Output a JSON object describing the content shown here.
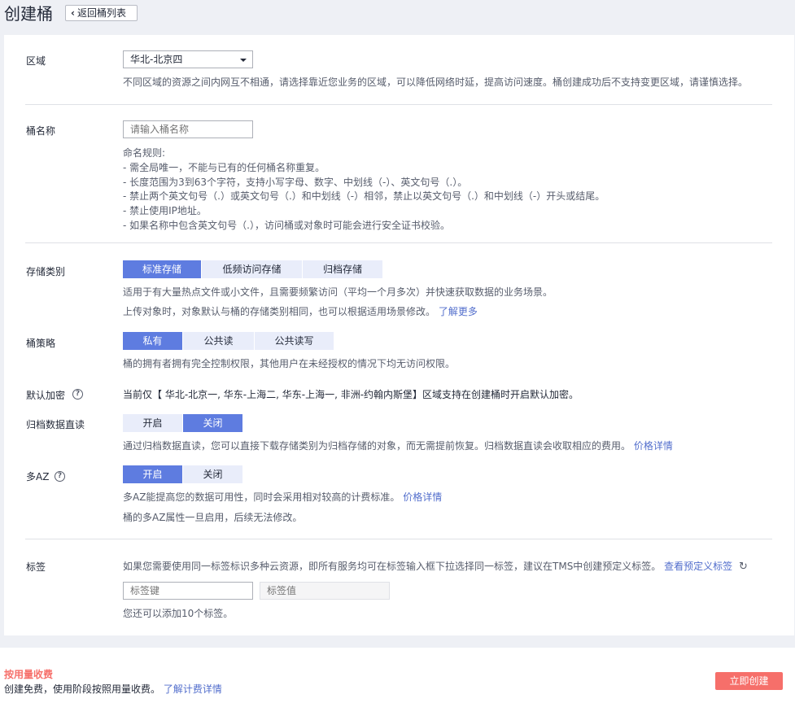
{
  "header": {
    "title": "创建桶",
    "back_label": "返回桶列表"
  },
  "region": {
    "label": "区域",
    "selected": "华北-北京四",
    "hint": "不同区域的资源之间内网互不相通，请选择靠近您业务的区域，可以降低网络时延，提高访问速度。桶创建成功后不支持变更区域，请谨慎选择。"
  },
  "bucket_name": {
    "label": "桶名称",
    "placeholder": "请输入桶名称",
    "rules": [
      "命名规则:",
      "- 需全局唯一，不能与已有的任何桶名称重复。",
      "- 长度范围为3到63个字符，支持小写字母、数字、中划线（-）、英文句号（.）。",
      "- 禁止两个英文句号（.）或英文句号（.）和中划线（-）相邻，禁止以英文句号（.）和中划线（-）开头或结尾。",
      "- 禁止使用IP地址。",
      "- 如果名称中包含英文句号（.），访问桶或对象时可能会进行安全证书校验。"
    ]
  },
  "storage_class": {
    "label": "存储类别",
    "options": [
      "标准存储",
      "低频访问存储",
      "归档存储"
    ],
    "hint1": "适用于有大量热点文件或小文件，且需要频繁访问（平均一个月多次）并快速获取数据的业务场景。",
    "hint2": "上传对象时，对象默认与桶的存储类别相同，也可以根据适用场景修改。",
    "learn_more": "了解更多"
  },
  "policy": {
    "label": "桶策略",
    "options": [
      "私有",
      "公共读",
      "公共读写"
    ],
    "hint": "桶的拥有者拥有完全控制权限，其他用户在未经授权的情况下均无访问权限。"
  },
  "encryption": {
    "label": "默认加密",
    "text": "当前仅【 华北-北京一, 华东-上海二, 华东-上海一, 非洲-约翰内斯堡】区域支持在创建桶时开启默认加密。"
  },
  "archive_read": {
    "label": "归档数据直读",
    "options": [
      "开启",
      "关闭"
    ],
    "hint": "通过归档数据直读，您可以直接下载存储类别为归档存储的对象，而无需提前恢复。归档数据直读会收取相应的费用。",
    "price_link": "价格详情"
  },
  "multi_az": {
    "label": "多AZ",
    "options": [
      "开启",
      "关闭"
    ],
    "hint1": "多AZ能提高您的数据可用性，同时会采用相对较高的计费标准。",
    "price_link": "价格详情",
    "hint2": "桶的多AZ属性一旦启用，后续无法修改。"
  },
  "tags": {
    "label": "标签",
    "hint": "如果您需要使用同一标签标识多种云资源，即所有服务均可在标签输入框下拉选择同一标签，建议在TMS中创建预定义标签。",
    "view_link": "查看预定义标签",
    "key_placeholder": "标签键",
    "value_placeholder": "标签值",
    "remaining": "您还可以添加10个标签。"
  },
  "footer": {
    "fee_title": "按用量收费",
    "fee_desc": "创建免费，使用阶段按照用量收费。",
    "fee_link": "了解计费详情",
    "create_label": "立即创建"
  },
  "icons": {
    "back": "chevron-left-icon",
    "help": "question-circle-icon",
    "refresh": "refresh-icon",
    "dropdown": "caret-down-icon"
  },
  "colors": {
    "primary": "#5e7ce0",
    "segment_bg": "#e9edfa",
    "link": "#526ecc",
    "danger": "#f66f6a"
  }
}
